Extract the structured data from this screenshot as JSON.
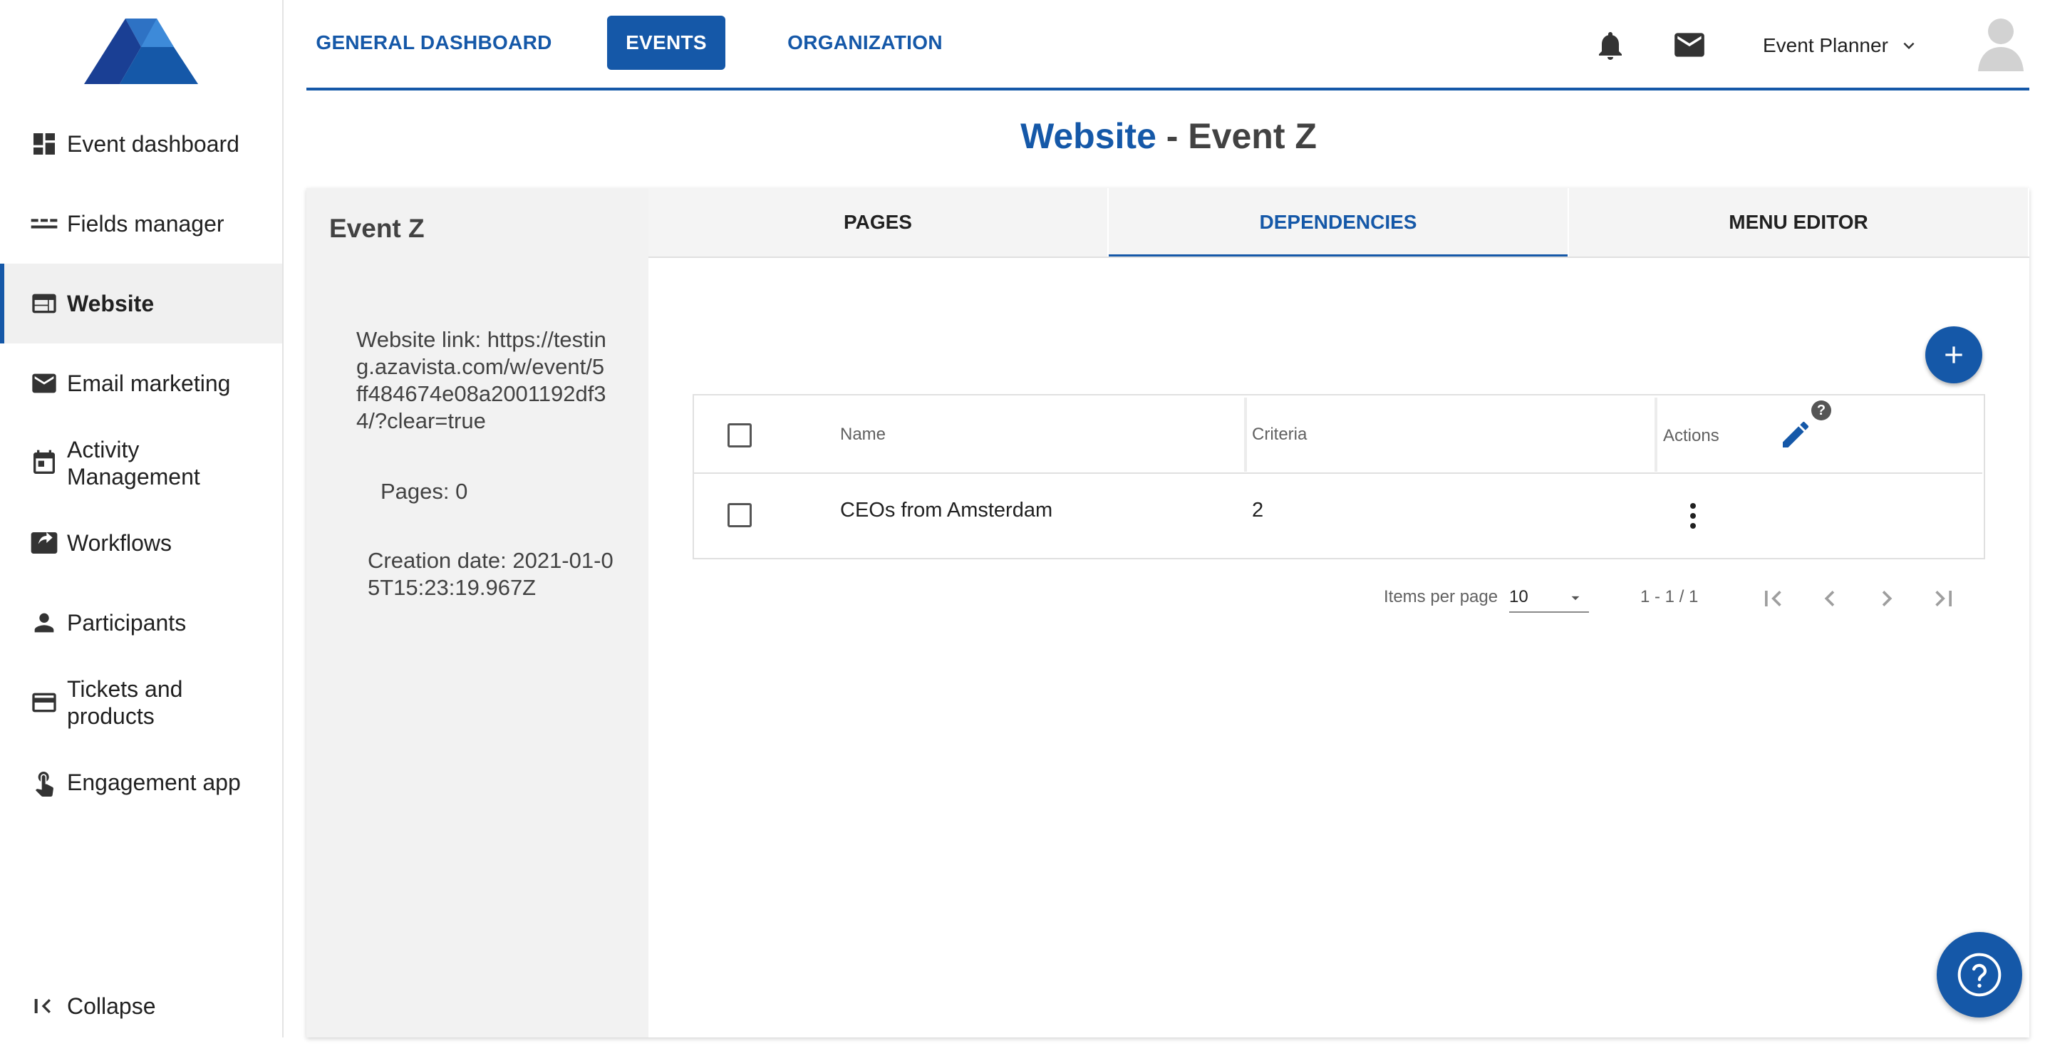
{
  "sidebar": {
    "items": [
      {
        "label": "Event dashboard",
        "icon": "dashboard-icon"
      },
      {
        "label": "Fields manager",
        "icon": "fields-icon"
      },
      {
        "label": "Website",
        "icon": "web-icon",
        "active": true
      },
      {
        "label": "Email marketing",
        "icon": "mail-icon"
      },
      {
        "label": "Activity Management",
        "icon": "calendar-icon"
      },
      {
        "label": "Workflows",
        "icon": "share-icon"
      },
      {
        "label": "Participants",
        "icon": "person-icon"
      },
      {
        "label": "Tickets and products",
        "icon": "card-icon"
      },
      {
        "label": "Engagement app",
        "icon": "touch-icon"
      }
    ],
    "collapse_label": "Collapse"
  },
  "topnav": {
    "links": [
      "GENERAL DASHBOARD",
      "EVENTS",
      "ORGANIZATION"
    ],
    "active": "EVENTS",
    "user_label": "Event Planner"
  },
  "page": {
    "title_accent": "Website",
    "title_rest": " - Event Z"
  },
  "event_info": {
    "name": "Event Z",
    "website_link_line1": "Website link: https://testin",
    "website_link_line2": "g.azavista.com/w/event/5",
    "website_link_line3": "ff484674e08a2001192df3",
    "website_link_line4": "4/?clear=true",
    "pages": "Pages: 0",
    "creation_line1": "Creation date: 2021-01-0",
    "creation_line2": "5T15:23:19.967Z"
  },
  "tabs": [
    "PAGES",
    "DEPENDENCIES",
    "MENU EDITOR"
  ],
  "active_tab": "DEPENDENCIES",
  "table": {
    "columns": [
      "Name",
      "Criteria",
      "Actions"
    ],
    "help_badge": "?",
    "rows": [
      {
        "name": "CEOs from Amsterdam",
        "criteria": "2"
      }
    ]
  },
  "pagination": {
    "items_per_page_label": "Items per page",
    "items_per_page_value": "10",
    "range": "1 - 1 / 1"
  },
  "colors": {
    "primary": "#1558a8",
    "text": "#212121",
    "muted": "#616161"
  }
}
